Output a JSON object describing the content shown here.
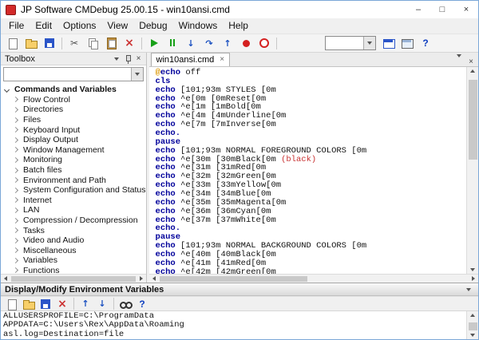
{
  "window": {
    "title": "JP Software CMDebug 25.00.15 - win10ansi.cmd",
    "controls": {
      "minimize": "–",
      "maximize": "□",
      "close": "×"
    }
  },
  "menu": {
    "items": [
      "File",
      "Edit",
      "Options",
      "View",
      "Debug",
      "Windows",
      "Help"
    ]
  },
  "main_toolbar": {
    "items": [
      "new-file",
      "open-folder",
      "save",
      "|",
      "cut",
      "copy",
      "paste",
      "delete",
      "|",
      "run",
      "pause",
      "step-into",
      "step-over",
      "step-out",
      "breakpoint",
      "stop",
      "|",
      "combo",
      "console",
      "window",
      "help"
    ]
  },
  "toolbox": {
    "title": "Toolbox",
    "filter_value": "",
    "root": "Commands and Variables",
    "items": [
      "Flow Control",
      "Directories",
      "Files",
      "Keyboard Input",
      "Display Output",
      "Window Management",
      "Monitoring",
      "Batch files",
      "Environment and Path",
      "System Configuration and Status",
      "Internet",
      "LAN",
      "Compression / Decompression",
      "Tasks",
      "Video and Audio",
      "Miscellaneous",
      "Variables",
      "Functions"
    ]
  },
  "editor": {
    "tab": "win10ansi.cmd",
    "lines": [
      [
        [
          "at",
          "@"
        ],
        [
          "kw",
          "echo"
        ],
        [
          "pl",
          " off"
        ]
      ],
      [
        [
          "kw",
          "cls"
        ]
      ],
      [
        [
          "kw",
          "echo"
        ],
        [
          "pl",
          " [101;93m STYLES [0m"
        ]
      ],
      [
        [
          "kw",
          "echo"
        ],
        [
          "pl",
          " ^e[0m [0mReset[0m"
        ]
      ],
      [
        [
          "kw",
          "echo"
        ],
        [
          "pl",
          " ^e[1m [1mBold[0m"
        ]
      ],
      [
        [
          "kw",
          "echo"
        ],
        [
          "pl",
          " ^e[4m [4mUnderline[0m"
        ]
      ],
      [
        [
          "kw",
          "echo"
        ],
        [
          "pl",
          " ^e[7m [7mInverse[0m"
        ]
      ],
      [
        [
          "kw",
          "echo."
        ]
      ],
      [
        [
          "kw",
          "pause"
        ]
      ],
      [
        [
          "kw",
          "echo"
        ],
        [
          "pl",
          " [101;93m NORMAL FOREGROUND COLORS [0m"
        ]
      ],
      [
        [
          "kw",
          "echo"
        ],
        [
          "pl",
          " ^e[30m [30mBlack[0m "
        ],
        [
          "rd",
          "(black)"
        ]
      ],
      [
        [
          "kw",
          "echo"
        ],
        [
          "pl",
          " ^e[31m [31mRed[0m"
        ]
      ],
      [
        [
          "kw",
          "echo"
        ],
        [
          "pl",
          " ^e[32m [32mGreen[0m"
        ]
      ],
      [
        [
          "kw",
          "echo"
        ],
        [
          "pl",
          " ^e[33m [33mYellow[0m"
        ]
      ],
      [
        [
          "kw",
          "echo"
        ],
        [
          "pl",
          " ^e[34m [34mBlue[0m"
        ]
      ],
      [
        [
          "kw",
          "echo"
        ],
        [
          "pl",
          " ^e[35m [35mMagenta[0m"
        ]
      ],
      [
        [
          "kw",
          "echo"
        ],
        [
          "pl",
          " ^e[36m [36mCyan[0m"
        ]
      ],
      [
        [
          "kw",
          "echo"
        ],
        [
          "pl",
          " ^e[37m [37mWhite[0m"
        ]
      ],
      [
        [
          "kw",
          "echo."
        ]
      ],
      [
        [
          "kw",
          "pause"
        ]
      ],
      [
        [
          "kw",
          "echo"
        ],
        [
          "pl",
          " [101;93m NORMAL BACKGROUND COLORS [0m"
        ]
      ],
      [
        [
          "kw",
          "echo"
        ],
        [
          "pl",
          " ^e[40m [40mBlack[0m"
        ]
      ],
      [
        [
          "kw",
          "echo"
        ],
        [
          "pl",
          " ^e[41m [41mRed[0m"
        ]
      ],
      [
        [
          "kw",
          "echo"
        ],
        [
          "pl",
          " ^e[42m [42mGreen[0m"
        ]
      ]
    ]
  },
  "bottom_panel": {
    "title": "Display/Modify Environment Variables",
    "toolbar": {
      "items": [
        "new-file",
        "open-folder",
        "save",
        "delete",
        "|",
        "move-up",
        "move-down",
        "|",
        "find",
        "help"
      ]
    },
    "env_vars": [
      "ALLUSERSPROFILE=C:\\ProgramData",
      "APPDATA=C:\\Users\\Rex\\AppData\\Roaming",
      "asl.log=Destination=file"
    ]
  },
  "colors": {
    "keyword_blue": "#00009b",
    "at_orange": "#dc9700",
    "error_red": "#c83232",
    "run_green": "#18a018",
    "record_red": "#d42020"
  }
}
